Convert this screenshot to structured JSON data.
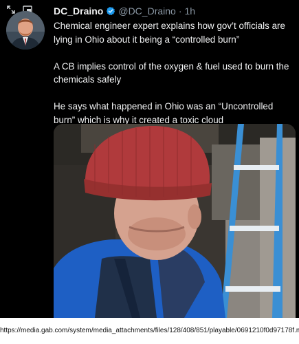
{
  "window": {
    "icons": [
      "expand-icon",
      "picture-in-picture-icon"
    ]
  },
  "tweet": {
    "author_name": "DC_Draino",
    "verified": true,
    "handle": "@DC_Draino",
    "separator": "·",
    "time": "1h",
    "paragraphs": [
      "Chemical engineer expert explains how gov’t officials are lying in Ohio about it being a “controlled burn”",
      "A CB implies control of the oxygen & fuel used to burn the chemicals safely",
      "He says what happened in Ohio was an “Uncontrolled burn” which is why it created a toxic cloud"
    ],
    "verified_color": "#1d9bf0"
  },
  "media": {
    "type": "video-frame"
  },
  "footer": {
    "url": "https://media.gab.com/system/media_attachments/files/128/408/851/playable/0691210f0d97178f.mp4"
  }
}
